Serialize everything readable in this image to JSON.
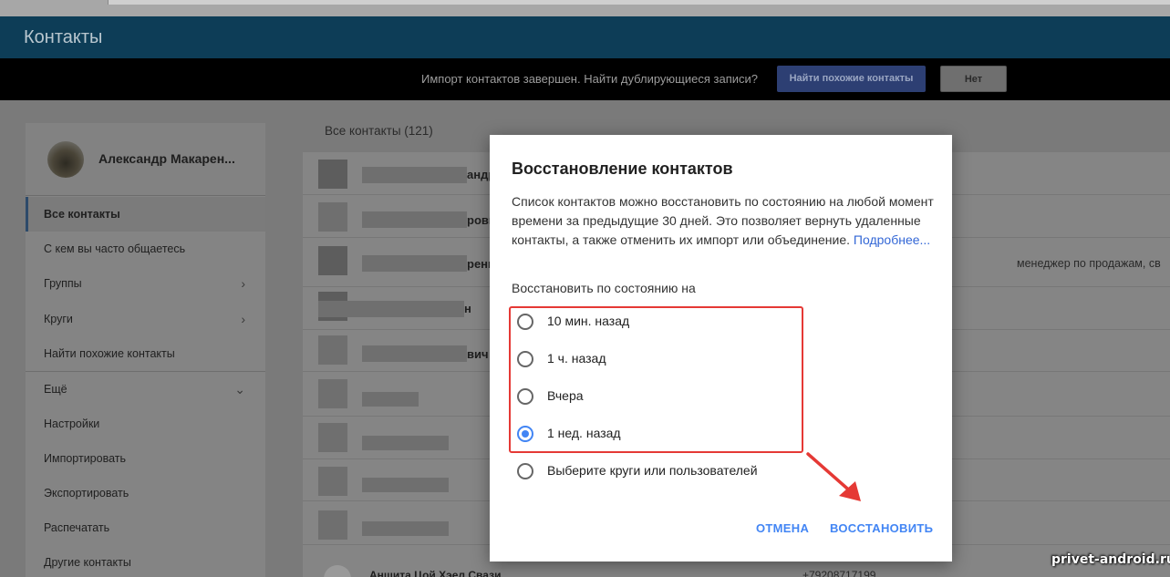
{
  "app": {
    "title": "Контакты"
  },
  "notice": {
    "text": "Импорт контактов завершен. Найти дублирующиеся записи?",
    "find_button": "Найти похожие контакты",
    "no_button": "Нет"
  },
  "sidebar": {
    "profile_name": "Александр Макарен...",
    "items": [
      {
        "label": "Все контакты",
        "active": true
      },
      {
        "label": "С кем вы часто общаетесь"
      },
      {
        "label": "Группы",
        "chevron": "chevron-right-icon"
      },
      {
        "label": "Круги",
        "chevron": "chevron-right-icon"
      },
      {
        "label": "Найти похожие контакты"
      },
      {
        "label": "Ещё",
        "chevron": "chevron-down-icon"
      },
      {
        "label": "Настройки"
      },
      {
        "label": "Импортировать"
      },
      {
        "label": "Экспортировать"
      },
      {
        "label": "Распечатать"
      },
      {
        "label": "Другие контакты"
      }
    ]
  },
  "main": {
    "list_title": "Все контакты (121)",
    "row_fragments": [
      "андр",
      "ровь",
      "ренк",
      "н",
      "вич"
    ],
    "row_right_text": "менеджер по продажам, св",
    "last_row_name": "Аншита Цой Хэел Свази",
    "last_row_phone": "+79208717199"
  },
  "dialog": {
    "title": "Восстановление контактов",
    "body": "Список контактов можно восстановить по состоянию на любой момент времени за предыдущие 30 дней. Это позволяет вернуть удаленные контакты, а также отменить их импорт или объединение.",
    "link": "Подробнее...",
    "restore_label": "Восстановить по состоянию на",
    "options": [
      {
        "label": "10 мин. назад",
        "checked": false
      },
      {
        "label": "1 ч. назад",
        "checked": false
      },
      {
        "label": "Вчера",
        "checked": false
      },
      {
        "label": "1 нед. назад",
        "checked": true
      },
      {
        "label": "Выберите круги или пользователей",
        "checked": false
      }
    ],
    "cancel_button": "ОТМЕНА",
    "restore_button": "ВОССТАНОВИТЬ"
  },
  "colors": {
    "header": "#0d3d57",
    "accent": "#4285f4",
    "highlight": "#e53935"
  },
  "watermark": "privet-android.ru"
}
